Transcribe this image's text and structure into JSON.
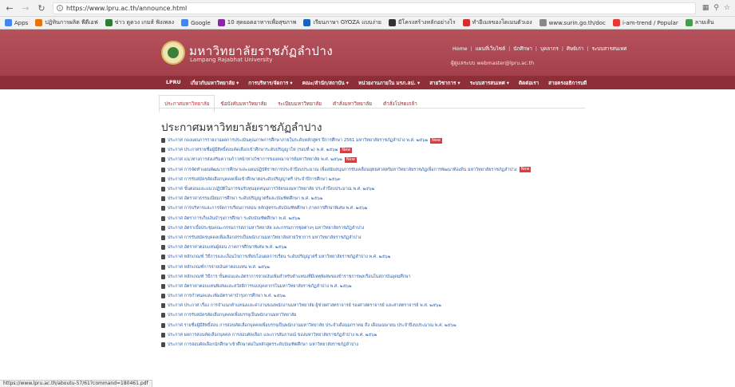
{
  "browser": {
    "url": "https://www.lpru.ac.th/announce.html",
    "status_url": "https://www.lpru.ac.th/aboutu-57/61?command=180461.pdf",
    "bookmarks": [
      {
        "label": "Apps",
        "icon": "apps-grid-icon",
        "color": "#4285f4"
      },
      {
        "label": "ปฏิทินการผลิต พีดีเอฟ",
        "icon": "bookmark-icon",
        "color": "#e8710a"
      },
      {
        "label": "ข่าว ดูดวง เกมส์ ฟังเพลง",
        "icon": "bookmark-icon",
        "color": "#2e7d32"
      },
      {
        "label": "Google",
        "icon": "google-icon",
        "color": "#4285f4"
      },
      {
        "label": "10 สุดยอดอาหารเพื่อสุขภาพ",
        "icon": "bookmark-icon",
        "color": "#8e24aa"
      },
      {
        "label": "เรียนภาษา GYOZA แบบง่าย",
        "icon": "bookmark-icon",
        "color": "#1565c0"
      },
      {
        "label": "มีโครงสร้างหลักอย่างไร",
        "icon": "pt-icon",
        "color": "#333333"
      },
      {
        "label": "ทำอีเมลของโดเมนตัวเอง",
        "icon": "bookmark-icon",
        "color": "#d32f2f"
      },
      {
        "label": "www.surin.go.th/doc",
        "icon": "page-icon",
        "color": "#888888"
      },
      {
        "label": "i-am-trend / Popular",
        "icon": "heart-icon",
        "color": "#e53935"
      },
      {
        "label": "ลายเส้น",
        "icon": "bookmark-icon",
        "color": "#43a047"
      }
    ]
  },
  "site": {
    "name": "มหาวิทยาลัยราชภัฏลำปาง",
    "subtitle": "Lampang Rajabhat University",
    "util_links": [
      "Home",
      "แผนที่เว็บไซต์",
      "นักศึกษา",
      "บุคลากร",
      "ศิษย์เก่า",
      "ระบบสารสนเทศ"
    ],
    "contact": "ผู้ดูแลระบบ webmaster@lpru.ac.th",
    "main_nav": [
      "LPRU",
      "เกี่ยวกับมหาวิทยาลัย ▾",
      "การบริหาร/จัดการ ▾",
      "คณะ/สำนัก/สถาบัน ▾",
      "หน่วยงานภายใน มรภ.ลป. ▾",
      "สายวิชาการ ▾",
      "ระบบสารสนเทศ ▾",
      "ติดต่อเรา",
      "สายตรงอธิการบดี"
    ]
  },
  "tabs": [
    "ประกาศมหาวิทยาลัย",
    "ข้อบังคับมหาวิทยาลัย",
    "ระเบียบมหาวิทยาลัย",
    "คำสั่งมหาวิทยาลัย",
    "คำสั่งโปรดเกล้า"
  ],
  "page_title": "ประกาศมหาวิทยาลัยราชภัฏลำปาง",
  "new_label": "New",
  "announcements": [
    {
      "text": "ประกาศ กองแผนการรายงานผลการประเมินคุณภาพการศึกษาภายในระดับหลักสูตร ปีการศึกษา 2561 มหาวิทยาลัยราชภัฏลำปาง พ.ศ. ๒๕๖๒",
      "new": true
    },
    {
      "text": "ประกาศ ประกาศรายชื่อผู้มีสิทธิ์สอบคัดเลือกเข้าศึกษาระดับปริญญาโท (รอบที่ ๒) พ.ศ. ๒๕๖๒",
      "new": true
    },
    {
      "text": "ประกาศ แนวทางการส่งเสริมความก้าวหน้าทางวิชาการของคณาจารย์มหาวิทยาลัย พ.ศ. ๒๕๖๒",
      "new": true
    },
    {
      "text": "ประกาศ การจัดทำแผนพัฒนาการศึกษาและแผนปฏิบัติราชการประจำปีงบประมาณ เพื่อสนับสนุนการขับเคลื่อนยุทธศาสตร์มหาวิทยาลัยราชภัฏเพื่อการพัฒนาท้องถิ่น มหาวิทยาลัยราชภัฏลำปาง",
      "new": true
    },
    {
      "text": "ประกาศ การรับสมัครคัดเลือกบุคคลเพื่อเข้าศึกษาต่อระดับปริญญาตรี ประจำปีการศึกษา ๒๕๖๓",
      "new": false
    },
    {
      "text": "ประกาศ ขั้นตอนและแนวปฏิบัติในการขอรับทุนอุดหนุนการวิจัยของมหาวิทยาลัย ประจำปีงบประมาณ พ.ศ. ๒๕๖๒",
      "new": false
    },
    {
      "text": "ประกาศ อัตราค่าธรรมเนียมการศึกษา ระดับปริญญาตรีและบัณฑิตศึกษา พ.ศ. ๒๕๖๒",
      "new": false
    },
    {
      "text": "ประกาศ การบริหารและการจัดการเรียนการสอน หลักสูตรระดับบัณฑิตศึกษา ภาคการศึกษาพิเศษ พ.ศ. ๒๕๖๒",
      "new": false
    },
    {
      "text": "ประกาศ อัตราการเก็บเงินบำรุงการศึกษา ระดับบัณฑิตศึกษา พ.ศ. ๒๕๖๒",
      "new": false
    },
    {
      "text": "ประกาศ อัตราเบี้ยประชุมคณะกรรมการสภามหาวิทยาลัย และกรรมการชุดต่างๆ มหาวิทยาลัยราชภัฏลำปาง",
      "new": false
    },
    {
      "text": "ประกาศ การรับสมัครบุคคลเพื่อเลือกสรรเป็นพนักงานมหาวิทยาลัยสายวิชาการ มหาวิทยาลัยราชภัฏลำปาง",
      "new": false
    },
    {
      "text": "ประกาศ อัตราค่าตอบแทนผู้สอน ภาคการศึกษาพิเศษ พ.ศ. ๒๕๖๒",
      "new": false
    },
    {
      "text": "ประกาศ หลักเกณฑ์ วิธีการและเงื่อนไขการเทียบโอนผลการเรียน ระดับปริญญาตรี มหาวิทยาลัยราชภัฏลำปาง พ.ศ. ๒๕๖๒",
      "new": false
    },
    {
      "text": "ประกาศ หลักเกณฑ์การจ่ายเงินค่าตอบแทน พ.ศ. ๒๕๖๒",
      "new": false
    },
    {
      "text": "ประกาศ หลักเกณฑ์ วิธีการ ขั้นตอนและอัตราการจ่ายเงินเพิ่มสำหรับตำแหน่งที่มีเหตุพิเศษของข้าราชการพลเรือนในสถาบันอุดมศึกษา",
      "new": false
    },
    {
      "text": "ประกาศ อัตราค่าตอบแทนพิเศษและสวัสดิการของบุคลากรในมหาวิทยาลัยราชภัฏลำปาง พ.ศ. ๒๕๖๒",
      "new": false
    },
    {
      "text": "ประกาศ การกำหนดและเพิ่มอัตราค่าบำรุงการศึกษา พ.ศ. ๒๕๖๒",
      "new": false
    },
    {
      "text": "ประกาศ ประกาศ เรื่อง การจำแนกตำแหน่งและค่างานของพนักงานมหาวิทยาลัย ผู้ช่วยศาสตราจารย์ รองศาสตราจารย์ และศาสตราจารย์ พ.ศ. ๒๕๖๒",
      "new": false
    },
    {
      "text": "ประกาศ การรับสมัครคัดเลือกบุคคลเพื่อบรรจุเป็นพนักงานมหาวิทยาลัย",
      "new": false
    },
    {
      "text": "ประกาศ รายชื่อผู้มีสิทธิ์สอบ การสอบคัดเลือกบุคคลเพื่อบรรจุเป็นพนักงานมหาวิทยาลัย ประจำเดือนมกราคม ถึง เดือนเมษายน ประจำปีงบประมาณ พ.ศ. ๒๕๖๒",
      "new": false
    },
    {
      "text": "ประกาศ ผลการสอบคัดเลือกบุคคล การสอบคัดเลือก และการสัมภาษณ์ ของมหาวิทยาลัยราชภัฏลำปาง พ.ศ. ๒๕๖๒",
      "new": false
    },
    {
      "text": "ประกาศ การสอบคัดเลือกนักศึกษาเข้าศึกษาต่อในหลักสูตรระดับบัณฑิตศึกษา มหาวิทยาลัยราชภัฏลำปาง",
      "new": false
    }
  ],
  "colors": {
    "header": "#a4404b",
    "nav": "#8e2f37",
    "link": "#2a5caa",
    "new_badge": "#e0393f"
  }
}
